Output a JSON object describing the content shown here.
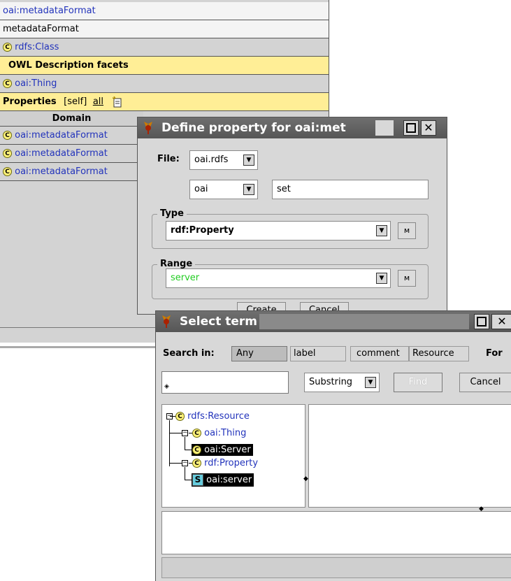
{
  "main_panel": {
    "rows": [
      {
        "text": "oai:metadataFormat"
      },
      {
        "text": "metadataFormat"
      },
      {
        "icon": "C",
        "text": "rdfs:Class"
      },
      {
        "text": "OWL Description facets"
      },
      {
        "icon": "C",
        "text": "oai:Thing"
      }
    ],
    "properties": {
      "label": "Properties",
      "self": "[self]",
      "all": "all"
    },
    "domain_header": "Domain",
    "domain_rows": [
      "oai:metadataFormat",
      "oai:metadataFormat",
      "oai:metadataFormat"
    ],
    "class_icon_letter": "C"
  },
  "define_dialog": {
    "title": "Define property for oai:met",
    "file_label": "File:",
    "file_value": "oai.rdfs",
    "prefix_value": "oai",
    "name_value": "set",
    "type_label": "Type",
    "type_value": "rdf:Property",
    "range_label": "Range",
    "range_value": "server",
    "range_color": "#22cc22",
    "create_label": "Create",
    "cancel_label": "Cancel"
  },
  "select_dialog": {
    "title": "Select term",
    "search_in_label": "Search in:",
    "search_options": [
      "Any",
      "label",
      "comment",
      "Resource"
    ],
    "for_label": "For",
    "search_value": "",
    "match_mode": "Substring",
    "find_label": "Find",
    "cancel_label": "Cancel",
    "tree": [
      {
        "icon": "C",
        "text": "rdfs:Resource"
      },
      {
        "icon": "C",
        "text": "oai:Thing"
      },
      {
        "icon": "C",
        "text": "oai:Server"
      },
      {
        "icon": "C",
        "text": "rdf:Property"
      },
      {
        "icon": "S",
        "text": "oai:server"
      }
    ],
    "selection_color": "#000000",
    "property_icon_color": "#66ccdd"
  },
  "icons": {
    "title_logo": "protege-logo-icon",
    "maximize": "maximize-icon",
    "close": "close-icon",
    "dropdown": "dropdown-arrow-icon",
    "find": "binoculars-icon",
    "add_property": "create-property-icon"
  }
}
